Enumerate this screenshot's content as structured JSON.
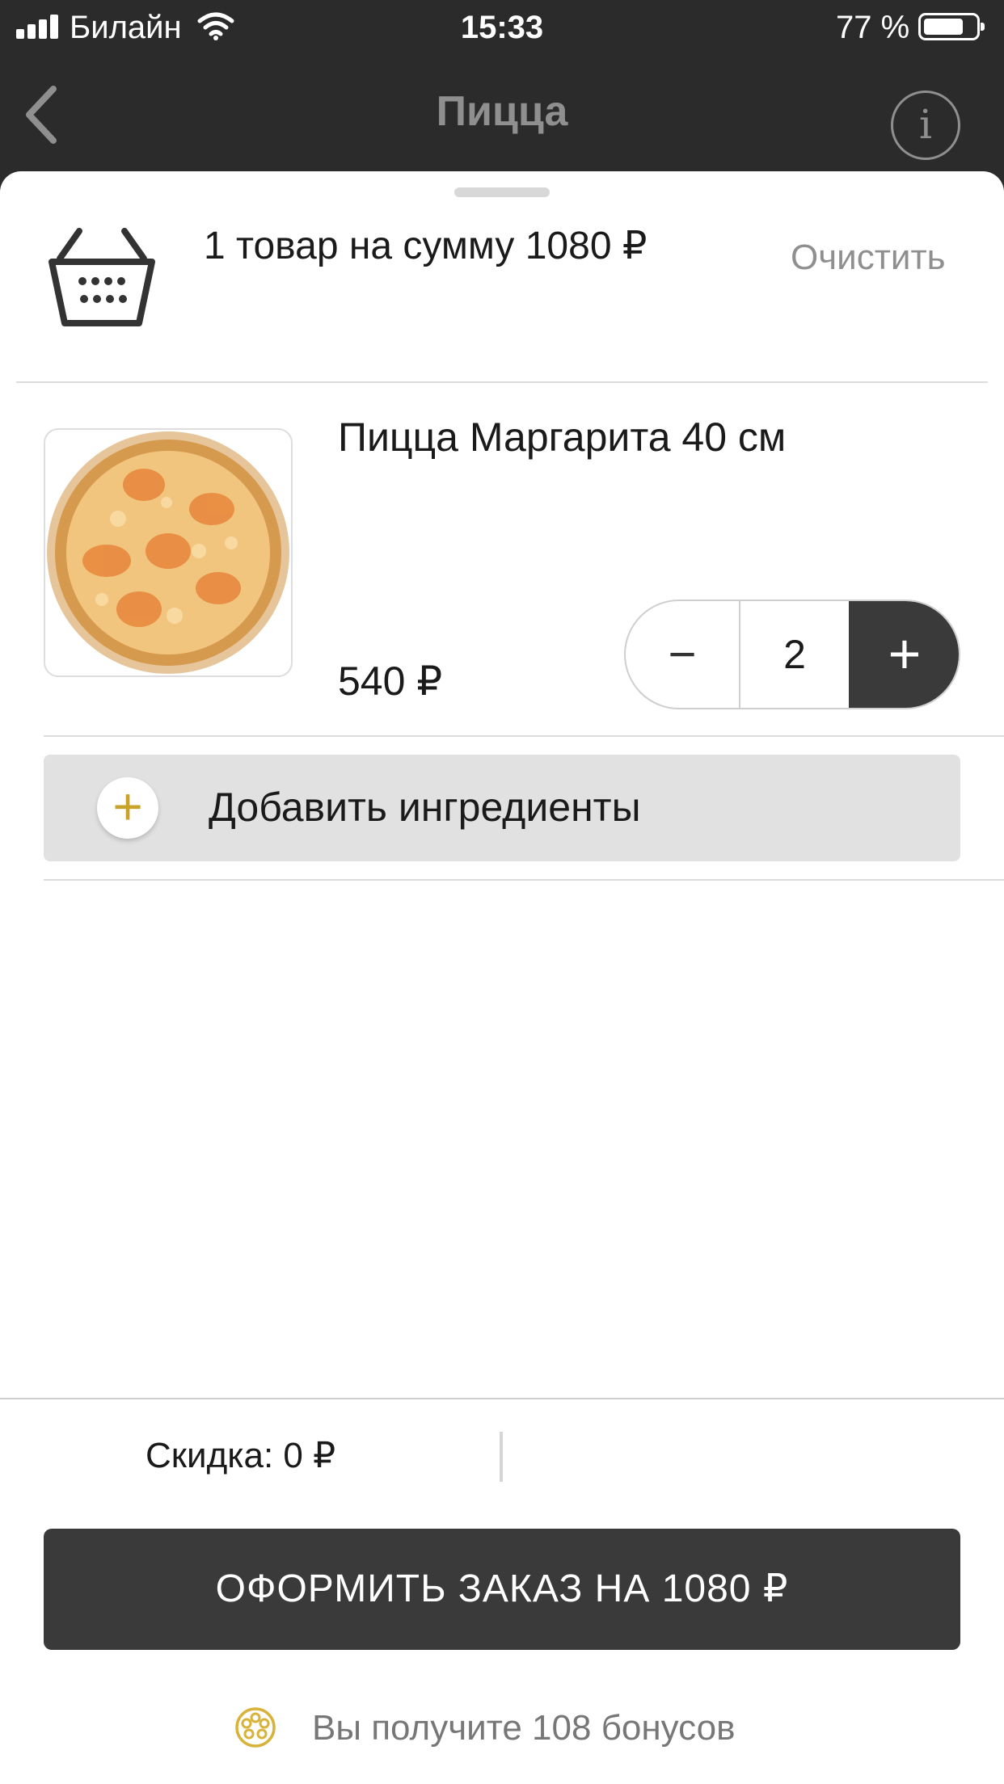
{
  "status_bar": {
    "carrier": "Билайн",
    "time": "15:33",
    "battery_percent": "77 %",
    "battery_level": 0.77
  },
  "nav": {
    "title": "Пицца",
    "back_icon": "chevron-left-icon",
    "info_icon": "info-icon",
    "info_glyph": "i"
  },
  "cart_header": {
    "summary": "1 товар на сумму 1080 ₽",
    "clear_label": "Очистить",
    "icon": "basket-icon"
  },
  "item": {
    "name": "Пицца Маргарита 40 см",
    "price": "540 ₽",
    "quantity": "2",
    "minus_label": "−",
    "plus_label": "+"
  },
  "add_ingredients": {
    "label": "Добавить ингредиенты",
    "plus_label": "+"
  },
  "footer": {
    "discount": "Скидка: 0 ₽",
    "checkout_label": "ОФОРМИТЬ ЗАКАЗ НА 1080 ₽",
    "bonus_text": "Вы получите 108 бонусов"
  },
  "colors": {
    "dark": "#2b2b2b",
    "button_dark": "#3a3a3a",
    "accent_gold": "#c9a227",
    "muted_text": "#8f8f8f"
  }
}
